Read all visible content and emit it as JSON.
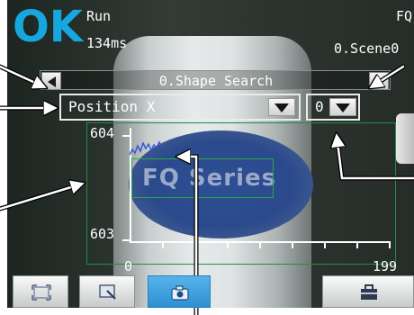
{
  "judgement": "OK",
  "header": {
    "mode": "Run",
    "processing_time": "134ms",
    "device_label": "FQ",
    "scene": "0.Scene0"
  },
  "item_bar": {
    "title": "0.Shape Search"
  },
  "param_select": {
    "value": "Position X"
  },
  "index_select": {
    "value": "0"
  },
  "graph": {
    "y_max_label": "604",
    "y_min_label": "603",
    "x_start_label": "0",
    "x_end_label": "199"
  },
  "product": {
    "logo_text": "FQ Series"
  },
  "colors": {
    "ok": "#17a7df",
    "graph_frame": "#1f8f45",
    "trend_line": "#2f54d8",
    "camera_button": "#3a9ddd"
  },
  "icons": {
    "prev": "triangle-left-icon",
    "next": "triangle-right-icon",
    "dropdown": "triangle-down-icon",
    "full_view": "fullscreen-icon",
    "zoom": "zoom-window-icon",
    "camera": "camera-icon",
    "tools": "toolbox-icon"
  }
}
